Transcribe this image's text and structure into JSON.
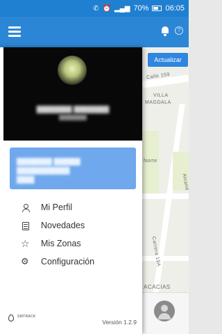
{
  "status_bar": {
    "battery": "70%",
    "time": "06:05"
  },
  "map": {
    "update_button": "Actualizar",
    "labels": [
      "Calle 159",
      "VILLA",
      "MAGDALA",
      "Norte",
      "Carrera 19A",
      "ACACIAS",
      "Alcand"
    ]
  },
  "drawer": {
    "menu": [
      {
        "label": "Mi Perfil",
        "icon": "person-icon"
      },
      {
        "label": "Novedades",
        "icon": "news-icon"
      },
      {
        "label": "Mis Zonas",
        "icon": "star-icon"
      },
      {
        "label": "Configuración",
        "icon": "gear-icon"
      }
    ],
    "version": "Versión 1.2.9",
    "brand": "SMTRACK"
  },
  "colors": {
    "primary": "#2c86d6",
    "card": "#6fa8ec"
  }
}
